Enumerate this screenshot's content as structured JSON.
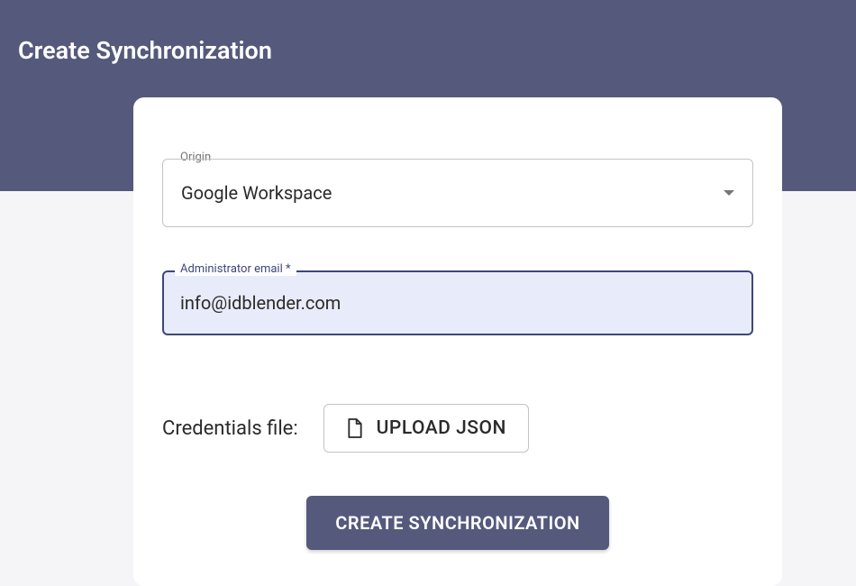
{
  "header": {
    "title": "Create Synchronization"
  },
  "form": {
    "origin": {
      "label": "Origin",
      "value": "Google Workspace"
    },
    "admin_email": {
      "label": "Administrator email *",
      "value": "info@idblender.com"
    },
    "credentials": {
      "label": "Credentials file:",
      "button_label": "UPLOAD JSON"
    },
    "submit_label": "CREATE SYNCHRONIZATION"
  }
}
